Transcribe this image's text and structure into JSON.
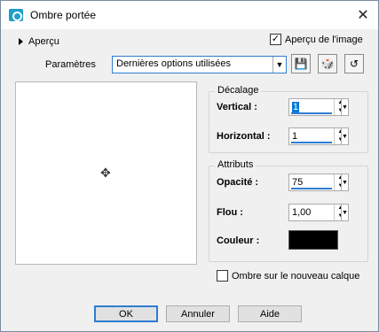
{
  "window": {
    "title": "Ombre portée"
  },
  "apercu": {
    "toggle_label": "Aperçu",
    "image_preview_label": "Aperçu de l'image",
    "image_preview_checked": true
  },
  "parametres": {
    "label": "Paramètres",
    "preset_value": "Dernières options utilisées"
  },
  "decalage": {
    "title": "Décalage",
    "vertical_label": "Vertical :",
    "vertical_value": "1",
    "horizontal_label": "Horizontal :",
    "horizontal_value": "1"
  },
  "attributs": {
    "title": "Attributs",
    "opacite_label": "Opacité :",
    "opacite_value": "75",
    "flou_label": "Flou :",
    "flou_value": "1,00",
    "couleur_label": "Couleur :",
    "couleur_value": "#000000"
  },
  "ombre_nouveau_calque": {
    "label": "Ombre sur le nouveau calque",
    "checked": false
  },
  "buttons": {
    "ok": "OK",
    "annuler": "Annuler",
    "aide": "Aide"
  }
}
